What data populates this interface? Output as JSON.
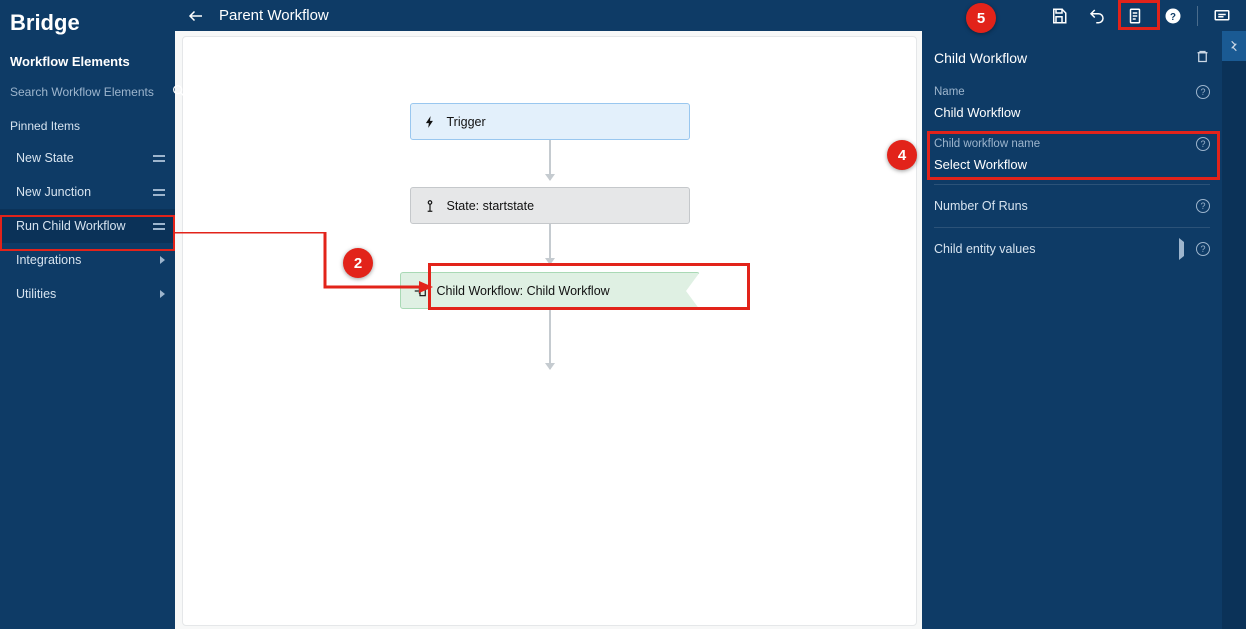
{
  "brand": "Bridge",
  "sidebar": {
    "section_title": "Workflow Elements",
    "search_placeholder": "Search Workflow Elements",
    "pinned_heading": "Pinned Items",
    "items": [
      {
        "label": "New State"
      },
      {
        "label": "New Junction"
      },
      {
        "label": "Run Child Workflow"
      },
      {
        "label": "Integrations"
      },
      {
        "label": "Utilities"
      }
    ]
  },
  "header": {
    "title": "Parent Workflow"
  },
  "canvas": {
    "nodes": {
      "trigger": {
        "label": "Trigger"
      },
      "state": {
        "label": "State: startstate"
      },
      "child": {
        "label": "Child Workflow: Child Workflow"
      }
    }
  },
  "inspector": {
    "title": "Child Workflow",
    "name_label": "Name",
    "name_value": "Child Workflow",
    "child_wf_label": "Child workflow name",
    "child_wf_value": "Select Workflow",
    "runs_label": "Number Of Runs",
    "entity_label": "Child entity values"
  },
  "annotations": {
    "b2": "2",
    "b4": "4",
    "b5": "5"
  }
}
